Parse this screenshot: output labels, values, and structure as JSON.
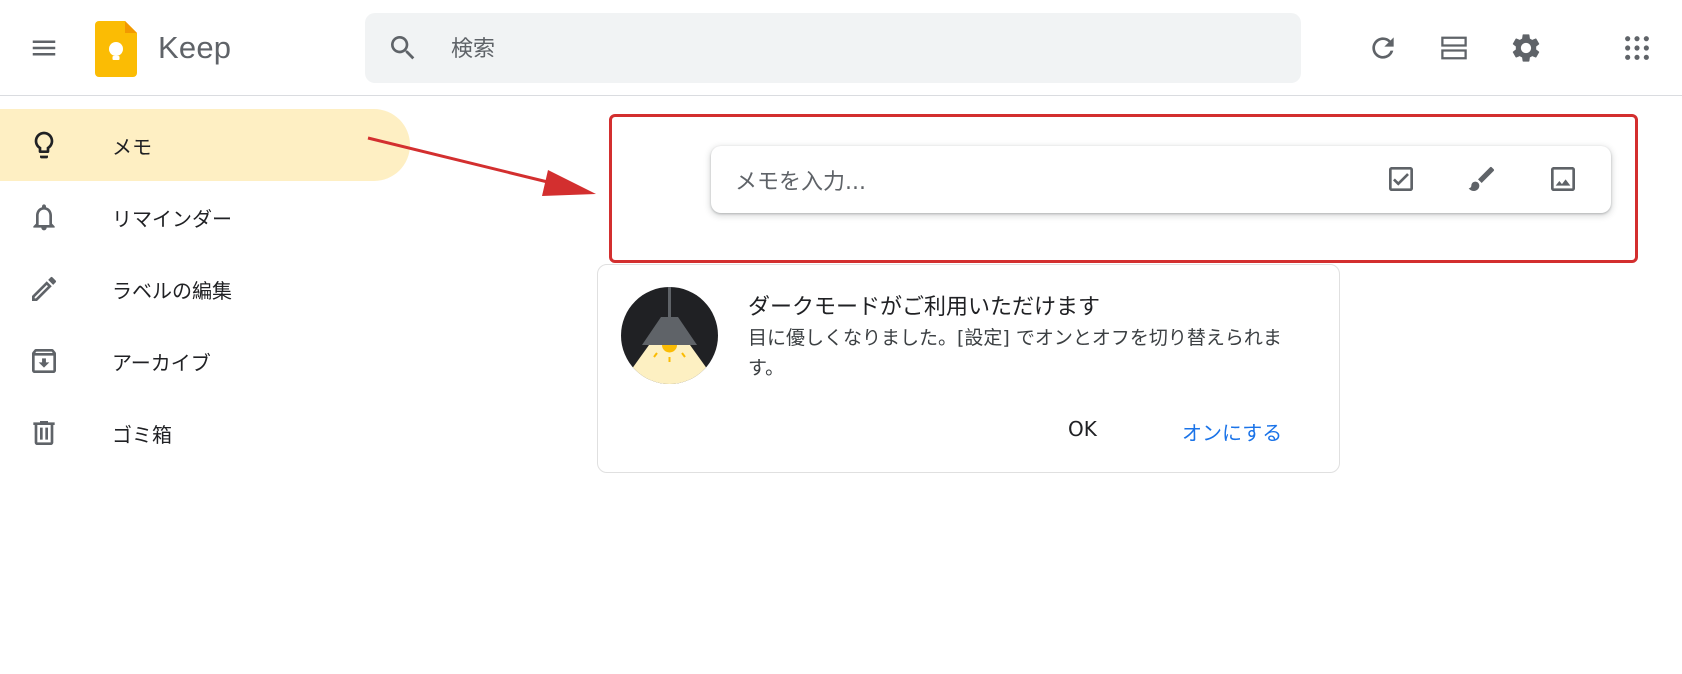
{
  "header": {
    "menu_icon": "hamburger-menu-icon",
    "logo_icon": "keep-logo-icon",
    "app_title": "Keep",
    "search": {
      "placeholder": "検索"
    },
    "actions": [
      {
        "icon": "refresh-icon"
      },
      {
        "icon": "list-view-icon"
      },
      {
        "icon": "gear-icon"
      },
      {
        "icon": "apps-grid-icon"
      }
    ]
  },
  "sidebar": {
    "items": [
      {
        "label": "メモ",
        "icon": "lightbulb-icon",
        "active": true
      },
      {
        "label": "リマインダー",
        "icon": "bell-icon",
        "active": false
      },
      {
        "label": "ラベルの編集",
        "icon": "pencil-icon",
        "active": false
      },
      {
        "label": "アーカイブ",
        "icon": "archive-icon",
        "active": false
      },
      {
        "label": "ゴミ箱",
        "icon": "trash-icon",
        "active": false
      }
    ]
  },
  "note_input": {
    "placeholder": "メモを入力...",
    "actions": [
      {
        "icon": "checkbox-icon"
      },
      {
        "icon": "brush-icon"
      },
      {
        "icon": "image-icon"
      }
    ]
  },
  "dark_mode_card": {
    "title": "ダークモードがご利用いただけます",
    "body": "目に優しくなりました。[設定] でオンとオフを切り替えられます。",
    "ok_label": "OK",
    "enable_label": "オンにする"
  },
  "colors": {
    "active_bg": "#feefc3",
    "annotation_red": "#d32f2f",
    "link_blue": "#1a73e8",
    "logo_yellow": "#fbbc04"
  }
}
